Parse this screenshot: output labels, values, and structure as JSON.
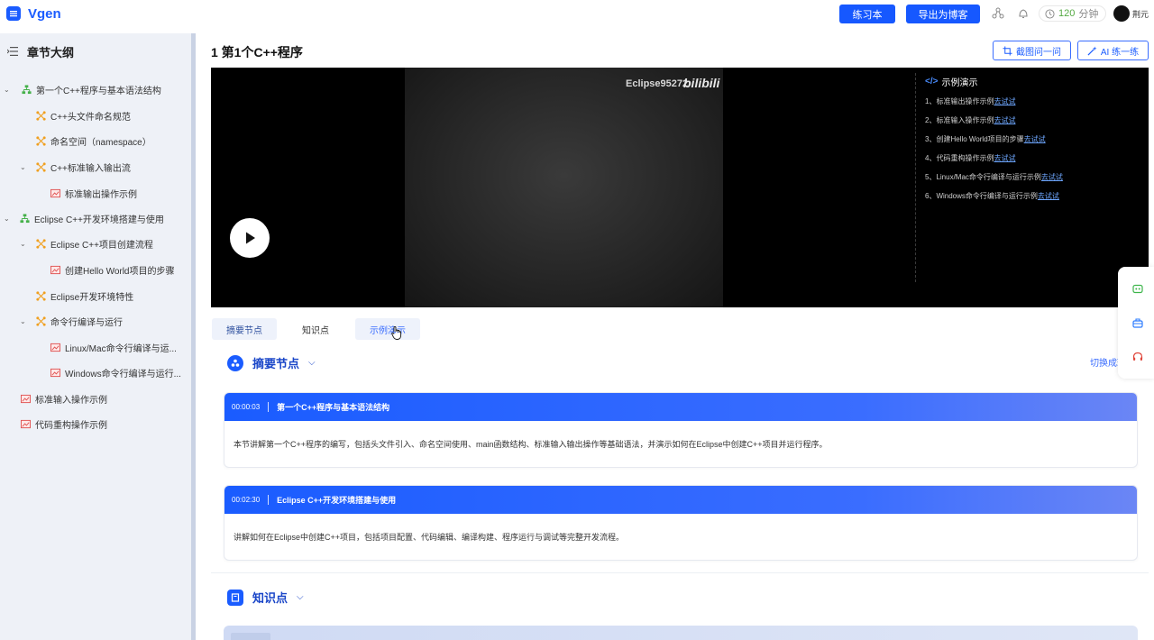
{
  "app": {
    "name": "Vgen",
    "practice_button": "练习本",
    "export_button": "导出为博客",
    "timer_value": "120",
    "timer_unit": "分钟",
    "user_name": "荆元"
  },
  "sidebar": {
    "title": "章节大纲",
    "items": [
      {
        "label": "第一个C++程序与基本语法结构"
      },
      {
        "label": "C++头文件命名规范"
      },
      {
        "label": "命名空间（namespace）"
      },
      {
        "label": "C++标准输入输出流"
      },
      {
        "label": "标准输出操作示例"
      },
      {
        "label": "Eclipse C++开发环境搭建与使用"
      },
      {
        "label": "Eclipse C++项目创建流程"
      },
      {
        "label": "创建Hello World项目的步骤"
      },
      {
        "label": "Eclipse开发环境特性"
      },
      {
        "label": "命令行编译与运行"
      },
      {
        "label": "Linux/Mac命令行编译与运..."
      },
      {
        "label": "Windows命令行编译与运行..."
      },
      {
        "label": "标准输入操作示例"
      },
      {
        "label": "代码重构操作示例"
      }
    ]
  },
  "main": {
    "title": "1 第1个C++程序",
    "screenshot_ask_button": "截图问一问",
    "ai_practice_button": "AI 练一练"
  },
  "video": {
    "watermark": "Eclipse95272",
    "bili_logo": "bilibili",
    "panel_code_icon": "</>",
    "panel_title": "示例演示",
    "demos": [
      {
        "text": "1、标准输出操作示例",
        "link": "去试试"
      },
      {
        "text": "2、标准输入操作示例",
        "link": "去试试"
      },
      {
        "text": "3、创建Hello World项目的步骤",
        "link": "去试试"
      },
      {
        "text": "4、代码重构操作示例",
        "link": "去试试"
      },
      {
        "text": "5、Linux/Mac命令行编译与运行示例",
        "link": "去试试"
      },
      {
        "text": "6、Windows命令行编译与运行示例",
        "link": "去试试"
      }
    ]
  },
  "tabs": [
    "摘要节点",
    "知识点",
    "示例演示"
  ],
  "summary": {
    "title": "摘要节点",
    "switch_label": "切换成环",
    "cards": [
      {
        "time": "00:00:03",
        "title": "第一个C++程序与基本语法结构",
        "body": "本节讲解第一个C++程序的编写，包括头文件引入、命名空间使用、main函数结构、标准输入输出操作等基础语法，并演示如何在Eclipse中创建C++项目并运行程序。"
      },
      {
        "time": "00:02:30",
        "title": "Eclipse C++开发环境搭建与使用",
        "body": "讲解如何在Eclipse中创建C++项目，包括项目配置、代码编辑、编译构建、程序运行与调试等完整开发流程。"
      }
    ]
  },
  "knowledge": {
    "title": "知识点"
  },
  "colors": {
    "accent": "#1a5cff",
    "sidebar_bg": "#eef1f7"
  }
}
